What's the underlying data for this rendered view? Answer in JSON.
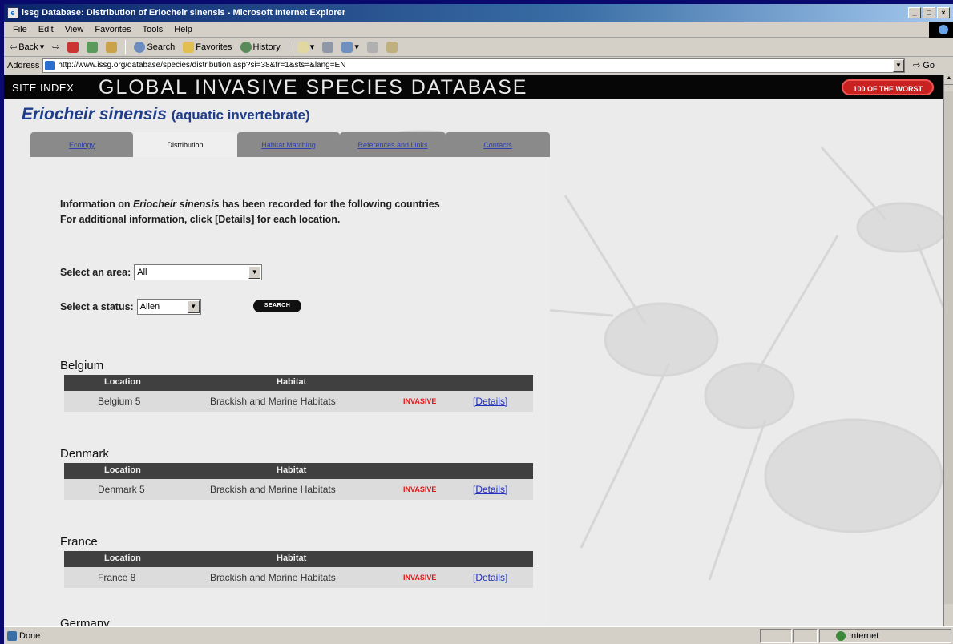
{
  "window": {
    "title": "issg Database: Distribution of Eriocheir sinensis - Microsoft Internet Explorer",
    "minimize": "_",
    "maximize": "□",
    "close": "×"
  },
  "menu": [
    "File",
    "Edit",
    "View",
    "Favorites",
    "Tools",
    "Help"
  ],
  "toolbar": {
    "back": "Back",
    "search": "Search",
    "favorites": "Favorites",
    "history": "History"
  },
  "address": {
    "label": "Address",
    "url": "http://www.issg.org/database/species/distribution.asp?si=38&fr=1&sts=&lang=EN",
    "go": "Go"
  },
  "site": {
    "index": "SITE INDEX",
    "title": "GLOBAL INVASIVE SPECIES DATABASE",
    "badge": "100 OF THE WORST"
  },
  "species": {
    "name": "Eriocheir sinensis",
    "category": "(aquatic invertebrate)"
  },
  "tabs": [
    {
      "label": "Ecology",
      "active": false
    },
    {
      "label": "Distribution",
      "active": true
    },
    {
      "label": "Habitat Matching",
      "active": false
    },
    {
      "label": "References and Links",
      "active": false
    },
    {
      "label": "Contacts",
      "active": false
    }
  ],
  "intro": {
    "line1_pre": "Information on ",
    "line1_species": "Eriocheir sinensis",
    "line1_post": " has been recorded for the following countries",
    "line2": "For additional information, click [Details] for each location."
  },
  "filters": {
    "area_label": "Select an area:",
    "area_value": "All",
    "status_label": "Select a status:",
    "status_value": "Alien",
    "search_button": "SEARCH"
  },
  "table_headers": {
    "location": "Location",
    "habitat": "Habitat"
  },
  "countries": [
    {
      "name": "Belgium",
      "location": "Belgium 5",
      "habitat": "Brackish and Marine Habitats",
      "status": "INVASIVE",
      "details": "[Details]"
    },
    {
      "name": "Denmark",
      "location": "Denmark 5",
      "habitat": "Brackish and Marine Habitats",
      "status": "INVASIVE",
      "details": "[Details]"
    },
    {
      "name": "France",
      "location": "France 8",
      "habitat": "Brackish and Marine Habitats",
      "status": "INVASIVE",
      "details": "[Details]"
    },
    {
      "name": "Germany"
    }
  ],
  "statusbar": {
    "text": "Done",
    "zone": "Internet"
  },
  "colors": {
    "species_title": "#1f3d8a",
    "invasive": "#e01515",
    "link": "#2030c0",
    "header_bg": "#060606",
    "badge": "#c92020"
  }
}
